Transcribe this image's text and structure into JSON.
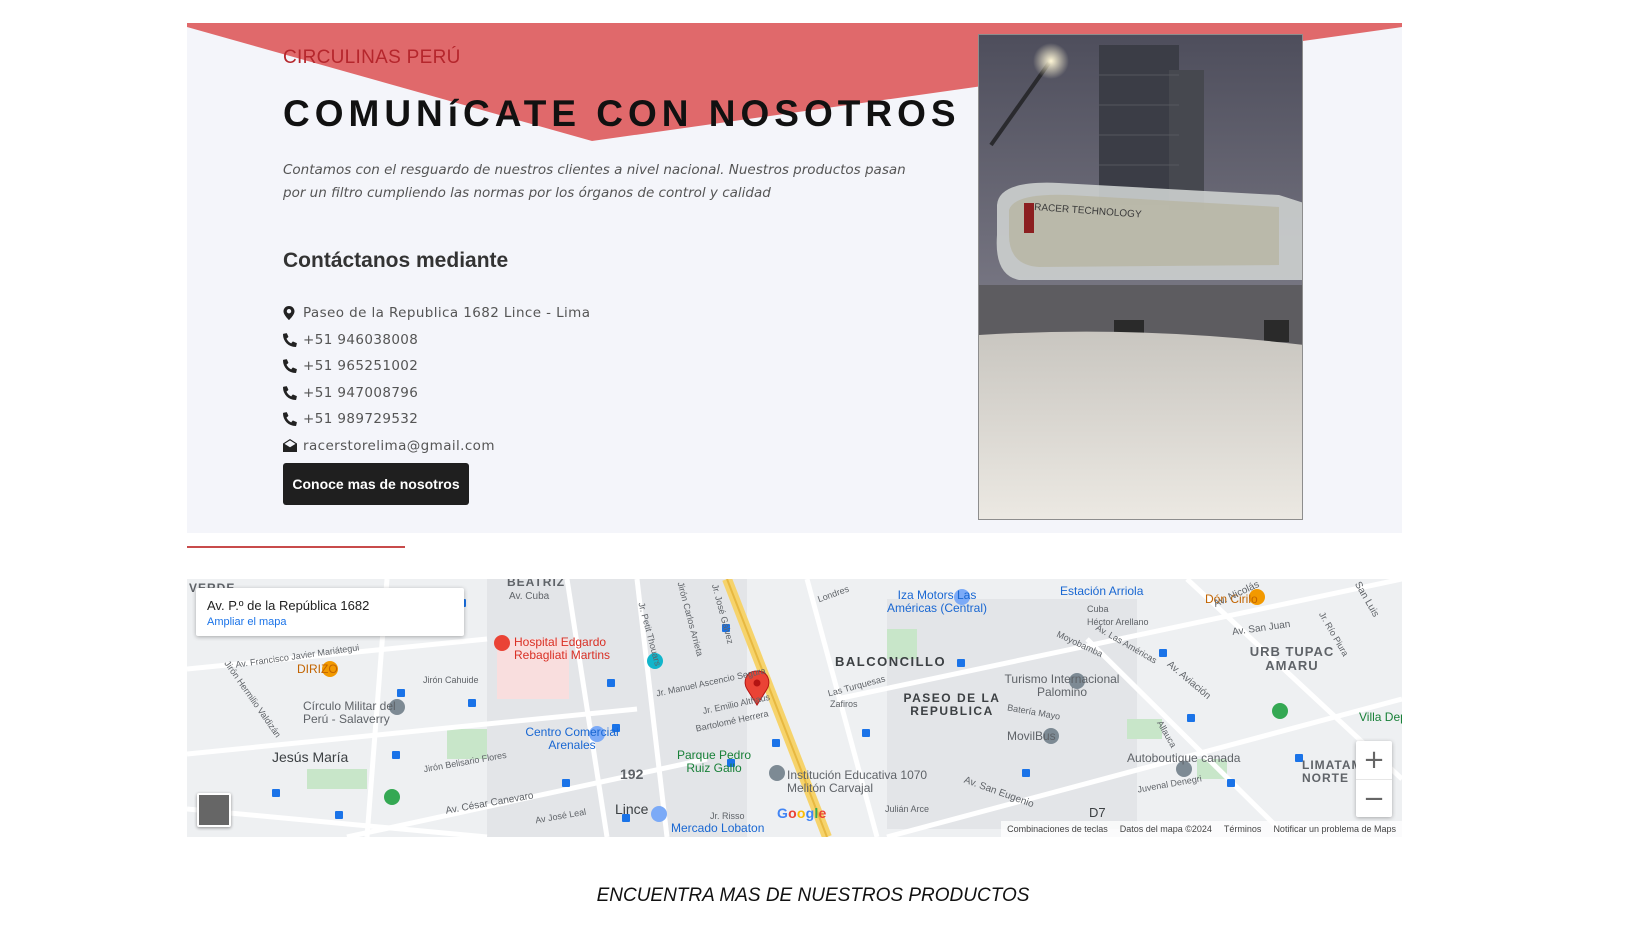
{
  "contact": {
    "brand": "CIRCULINAS PERÚ",
    "title": "COMUNíCATE CON NOSOTROS",
    "description": "Contamos con el resguardo de nuestros clientes a nivel nacional. Nuestros productos pasan por un filtro cumpliendo las normas por los órganos de control y calidad",
    "heading": "Contáctanos mediante",
    "items": [
      {
        "icon": "map-marker-icon",
        "text": "Paseo de la Republica 1682 Lince - Lima"
      },
      {
        "icon": "phone-icon",
        "text": "+51 946038008"
      },
      {
        "icon": "phone-icon",
        "text": "+51 965251002"
      },
      {
        "icon": "phone-icon",
        "text": "+51 947008796"
      },
      {
        "icon": "phone-icon",
        "text": "+51 989729532"
      },
      {
        "icon": "envelope-open-icon",
        "text": "racerstorelima@gmail.com"
      }
    ],
    "button_label": "Conoce mas de nosotros",
    "photo_text": "RACER TECHNOLOGY",
    "accent_color": "#e0696b"
  },
  "map": {
    "place_title": "Av. P.º de la República 1682",
    "enlarge_label": "Ampliar el mapa",
    "labels": [
      "BEATRIZ",
      "Av. Cuba",
      "VERDE",
      "Av. Francisco Javier Mariátegui",
      "DIRIZO",
      "Jirón Cahuide",
      "Jirón Hermilio Valdizán",
      "Círculo Militar del Perú - Salaverry",
      "Jesús María",
      "Jirón Belisario Flores",
      "Av. César Canevaro",
      "Av José Leal",
      "Lince",
      "192",
      "Hospital Edgardo Rebagliati Martins",
      "Centro Comercial Arenales",
      "Parque Pedro Ruiz Gallo",
      "Jr. Manuel Ascencio Segura",
      "Jr. Emilio Althaus",
      "Bartolomé Herrera",
      "Jr. Risso",
      "Mercado Lobaton",
      "Institución Educativa 1070 Melitón Carvajal",
      "Julián Arce",
      "BALCONCILLO",
      "PASEO DE LA REPUBLICA",
      "Las Turquesas",
      "Zafiros",
      "Iza Motors Las Américas (Central)",
      "Estación Arriola",
      "Cuba",
      "Héctor Arellano",
      "Av. Las Américas",
      "Moyobamba",
      "Turismo Internacional Palomino",
      "Batería Mayo",
      "MovilBus",
      "Av. San Eugenio",
      "D7",
      "Av. Aviación",
      "Allauca",
      "Juvenal Denegri",
      "Autoboutique canada",
      "Av. San Juan",
      "URB TUPAC AMARU",
      "Dón Cirilo",
      "Av. Nicolás",
      "San Luis",
      "Jr. Río Piura",
      "LIMATAMBO NORTE",
      "Villa Dep",
      "Jr. Petit Thouars",
      "Jirón Carlos Arrieta",
      "Jr. José Gálvez",
      "Londres"
    ],
    "zoom_in": "+",
    "zoom_out": "−",
    "google_logo": [
      "G",
      "o",
      "o",
      "g",
      "l",
      "e"
    ],
    "footer": [
      "Combinaciones de teclas",
      "Datos del mapa ©2024",
      "Términos",
      "Notificar un problema de Maps"
    ]
  },
  "products": {
    "heading": "ENCUENTRA MAS DE NUESTROS PRODUCTOS"
  }
}
